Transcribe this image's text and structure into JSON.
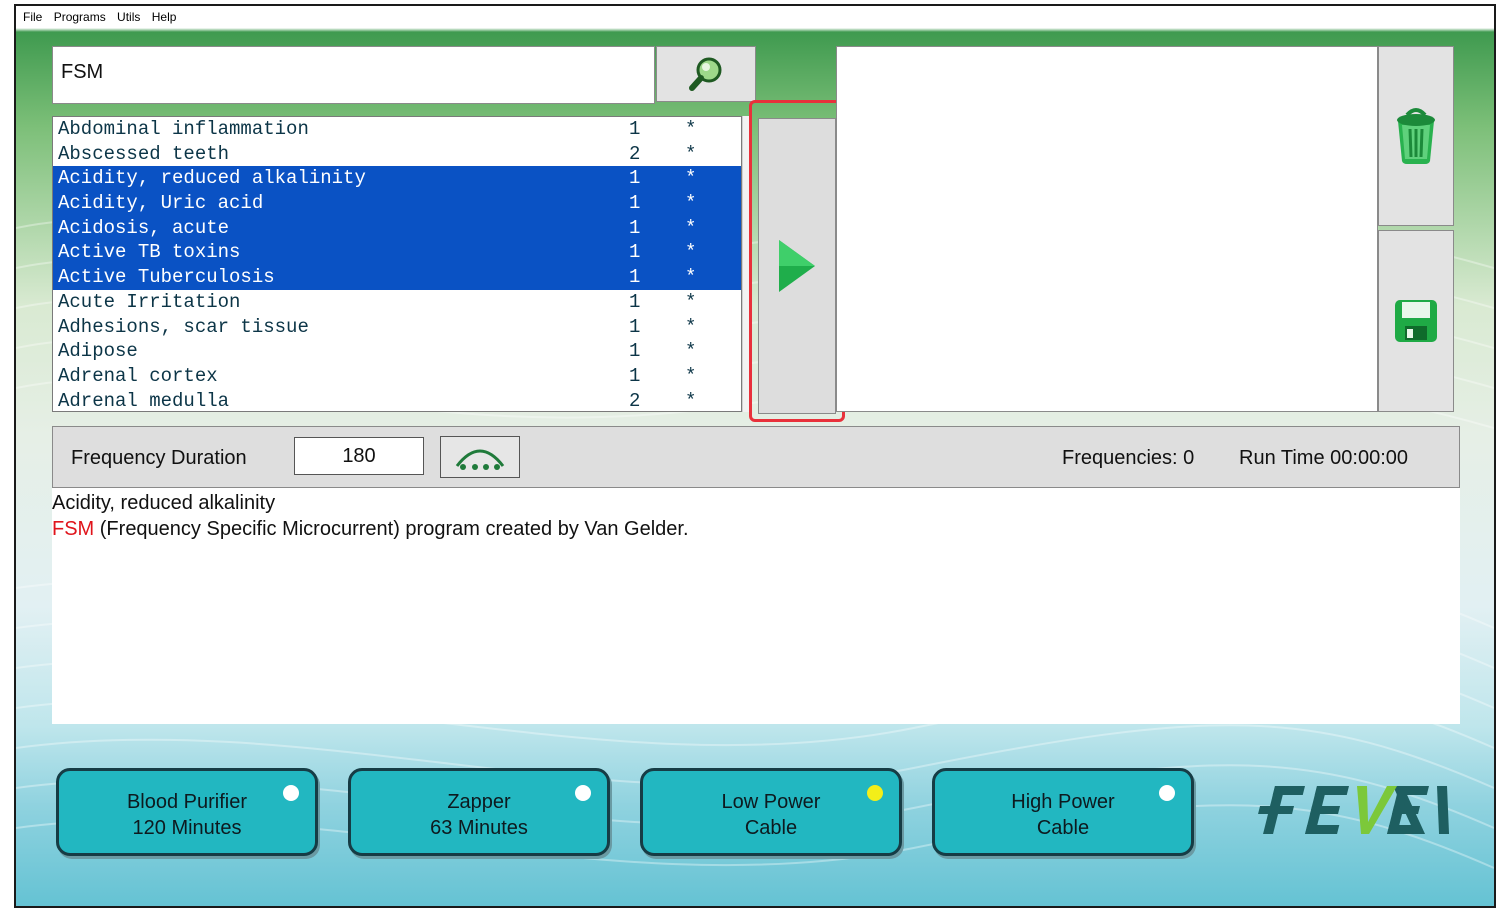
{
  "menu": [
    "File",
    "Programs",
    "Utils",
    "Help"
  ],
  "search": {
    "value": "FSM",
    "icon": "magnifier-icon"
  },
  "program_list": [
    {
      "name": "Abdominal inflammation",
      "count": "1",
      "mark": "*",
      "selected": false
    },
    {
      "name": "Abscessed teeth",
      "count": "2",
      "mark": "*",
      "selected": false
    },
    {
      "name": "Acidity, reduced alkalinity",
      "count": "1",
      "mark": "*",
      "selected": true
    },
    {
      "name": "Acidity, Uric acid",
      "count": "1",
      "mark": "*",
      "selected": true
    },
    {
      "name": "Acidosis, acute",
      "count": "1",
      "mark": "*",
      "selected": true
    },
    {
      "name": "Active TB toxins",
      "count": "1",
      "mark": "*",
      "selected": true
    },
    {
      "name": "Active Tuberculosis",
      "count": "1",
      "mark": "*",
      "selected": true
    },
    {
      "name": "Acute Irritation",
      "count": "1",
      "mark": "*",
      "selected": false
    },
    {
      "name": "Adhesions, scar tissue",
      "count": "1",
      "mark": "*",
      "selected": false
    },
    {
      "name": "Adipose",
      "count": "1",
      "mark": "*",
      "selected": false
    },
    {
      "name": "Adrenal cortex",
      "count": "1",
      "mark": "*",
      "selected": false
    },
    {
      "name": "Adrenal medulla",
      "count": "2",
      "mark": "*",
      "selected": false
    }
  ],
  "frequency_bar": {
    "duration_label": "Frequency Duration",
    "duration_value": "180",
    "frequencies_text": "Frequencies: 0",
    "runtime_text": "Run Time 00:00:00"
  },
  "info": {
    "title": "Acidity, reduced alkalinity",
    "desc_prefix": "FSM",
    "desc_rest": " (Frequency Specific Microcurrent) program created by Van Gelder."
  },
  "devices": [
    {
      "line1": "Blood Purifier",
      "line2": "120 Minutes",
      "indicator": "#ffffff"
    },
    {
      "line1": "Zapper",
      "line2": "63 Minutes",
      "indicator": "#ffffff"
    },
    {
      "line1": "Low Power",
      "line2": "Cable",
      "indicator": "#f3ee19"
    },
    {
      "line1": "High Power",
      "line2": "Cable",
      "indicator": "#ffffff"
    }
  ],
  "colors": {
    "selection": "#0a52c4",
    "highlight": "#e8313b",
    "device_button": "#22b7c1",
    "play": "#1fae4b"
  },
  "logo": "FEVEN"
}
